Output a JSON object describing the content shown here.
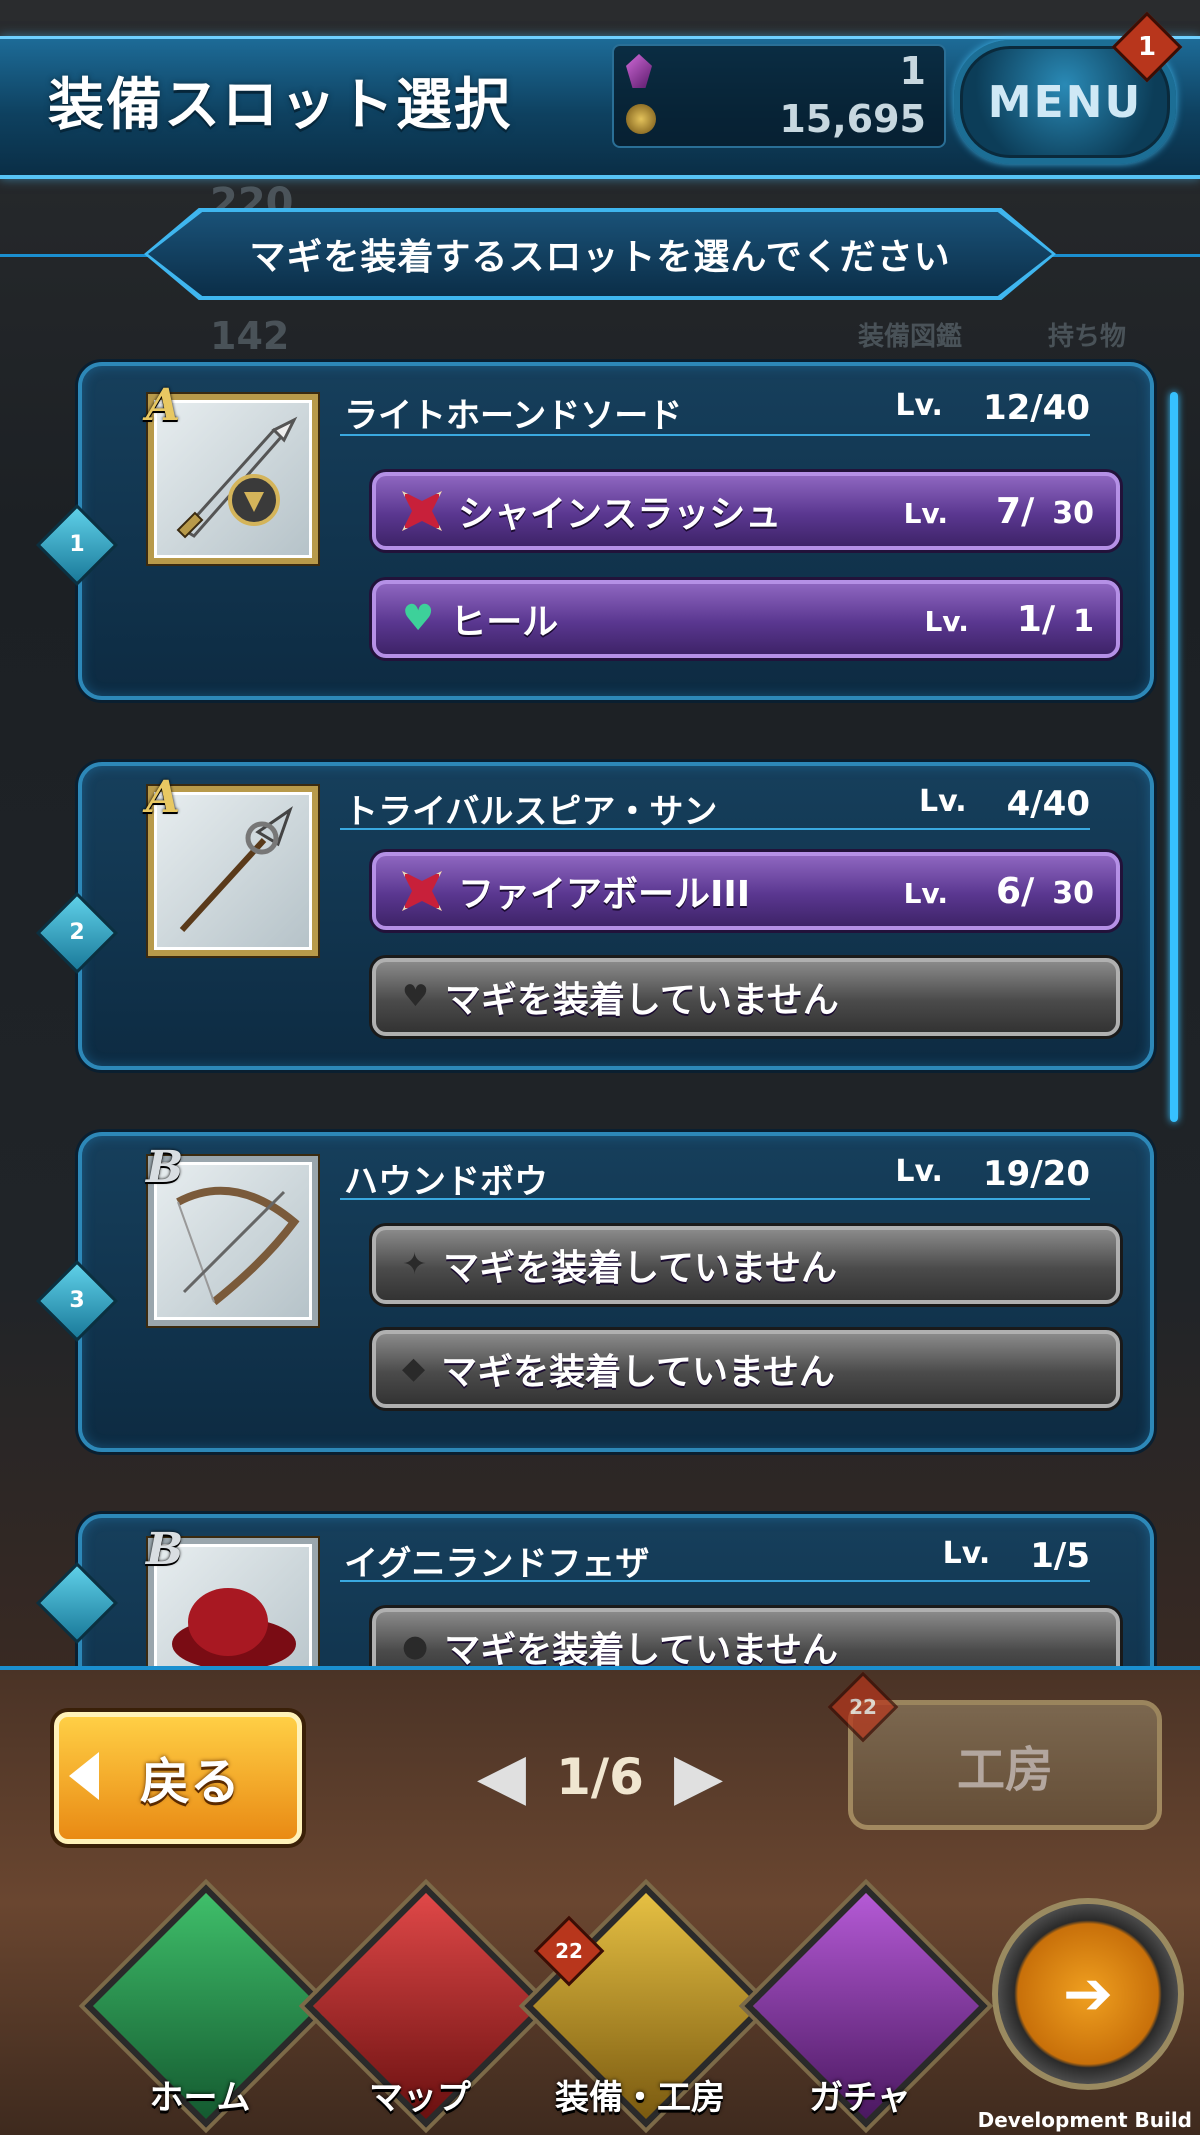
{
  "header": {
    "title": "装備スロット選択",
    "gems": "1",
    "coins": "15,695",
    "menu_label": "MENU",
    "menu_badge": "1"
  },
  "background": {
    "stat1": "220",
    "stat2": "142",
    "badge": "1",
    "shortcut1": "装備図鑑",
    "shortcut2": "持ち物"
  },
  "instruction": "マギを装着するスロットを選んでください",
  "slots": [
    {
      "slot_no": "1",
      "rank": "A",
      "name": "ライトホーンドソード",
      "lv_label": "Lv.",
      "level": "12/40",
      "magi": [
        {
          "icon": "red-crystal-icon",
          "name": "シャインスラッシュ",
          "lv_label": "Lv.",
          "level": "7/",
          "max": "30"
        },
        {
          "icon": "heart-icon",
          "name": "ヒール",
          "lv_label": "Lv.",
          "level": "1/",
          "max": "1"
        }
      ]
    },
    {
      "slot_no": "2",
      "rank": "A",
      "name": "トライバルスピア・サン",
      "lv_label": "Lv.",
      "level": "4/40",
      "magi": [
        {
          "icon": "red-crystal-icon",
          "name": "ファイアボールIII",
          "lv_label": "Lv.",
          "level": "6/",
          "max": "30"
        },
        {
          "icon": "heart-outline-icon",
          "name": "マギを装着していません"
        }
      ]
    },
    {
      "slot_no": "3",
      "rank": "B",
      "name": "ハウンドボウ",
      "lv_label": "Lv.",
      "level": "19/20",
      "magi": [
        {
          "icon": "crystal-outline-icon",
          "name": "マギを装着していません"
        },
        {
          "icon": "diamond-outline-icon",
          "name": "マギを装着していません"
        }
      ]
    },
    {
      "slot_no": "",
      "rank": "B",
      "name": "イグニランドフェザ",
      "lv_label": "Lv.",
      "level": "1/5",
      "magi": [
        {
          "icon": "circle-outline-icon",
          "name": "マギを装着していません"
        }
      ]
    }
  ],
  "bottom": {
    "back_label": "戻る",
    "page": "1/6",
    "workshop_label": "工房",
    "workshop_badge": "22"
  },
  "nav": {
    "home": "ホーム",
    "map": "マップ",
    "equip": "装備・工房",
    "equip_badge": "22",
    "gacha": "ガチャ"
  },
  "dev_build": "Development Build"
}
